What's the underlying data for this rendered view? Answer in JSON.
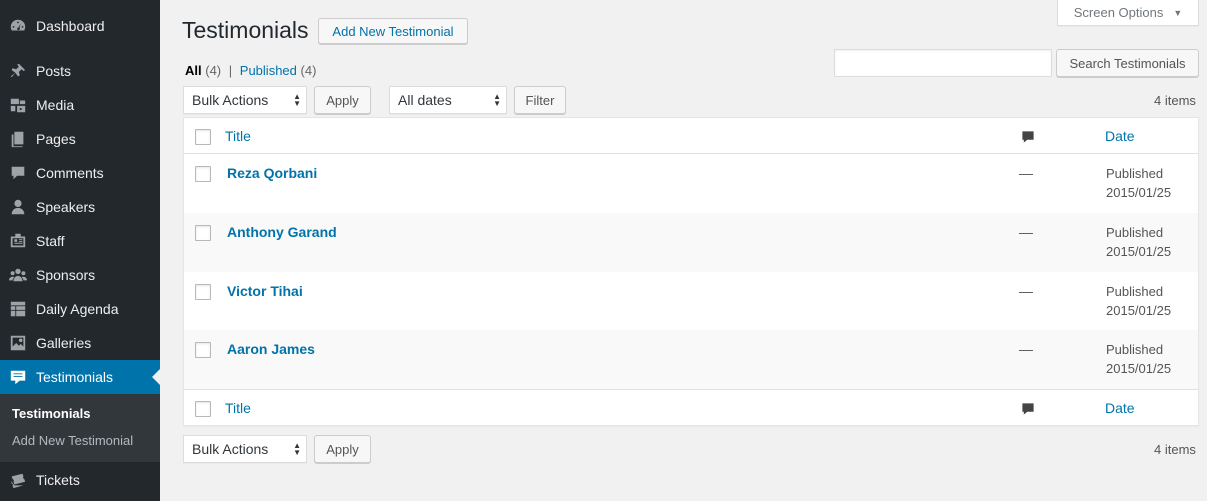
{
  "sidebar": {
    "items": [
      {
        "label": "Dashboard",
        "icon": "dashboard-icon"
      },
      {
        "label": "Posts",
        "icon": "pin-icon"
      },
      {
        "label": "Media",
        "icon": "media-icon"
      },
      {
        "label": "Pages",
        "icon": "pages-icon"
      },
      {
        "label": "Comments",
        "icon": "comment-icon"
      },
      {
        "label": "Speakers",
        "icon": "person-icon"
      },
      {
        "label": "Staff",
        "icon": "id-card-icon"
      },
      {
        "label": "Sponsors",
        "icon": "groups-icon"
      },
      {
        "label": "Daily Agenda",
        "icon": "grid-icon"
      },
      {
        "label": "Galleries",
        "icon": "gallery-icon"
      },
      {
        "label": "Testimonials",
        "icon": "testimonial-icon"
      },
      {
        "label": "Tickets",
        "icon": "tickets-icon"
      }
    ],
    "submenu": [
      "Testimonials",
      "Add New Testimonial"
    ]
  },
  "header": {
    "title": "Testimonials",
    "add_new": "Add New Testimonial",
    "screen_options": "Screen Options"
  },
  "filters": {
    "all_label": "All",
    "all_count": "(4)",
    "separator": "|",
    "published_label": "Published",
    "published_count": "(4)",
    "search_button": "Search Testimonials",
    "bulk_actions": "Bulk Actions",
    "apply": "Apply",
    "all_dates": "All dates",
    "filter": "Filter",
    "items_count": "4 items"
  },
  "table": {
    "col_title": "Title",
    "col_date": "Date",
    "rows": [
      {
        "title": "Reza Qorbani",
        "comments": "—",
        "status": "Published",
        "date": "2015/01/25"
      },
      {
        "title": "Anthony Garand",
        "comments": "—",
        "status": "Published",
        "date": "2015/01/25"
      },
      {
        "title": "Victor Tihai",
        "comments": "—",
        "status": "Published",
        "date": "2015/01/25"
      },
      {
        "title": "Aaron James",
        "comments": "—",
        "status": "Published",
        "date": "2015/01/25"
      }
    ]
  },
  "colors": {
    "sidebar_bg": "#23282d",
    "active_bg": "#0073aa",
    "link": "#0073aa"
  }
}
